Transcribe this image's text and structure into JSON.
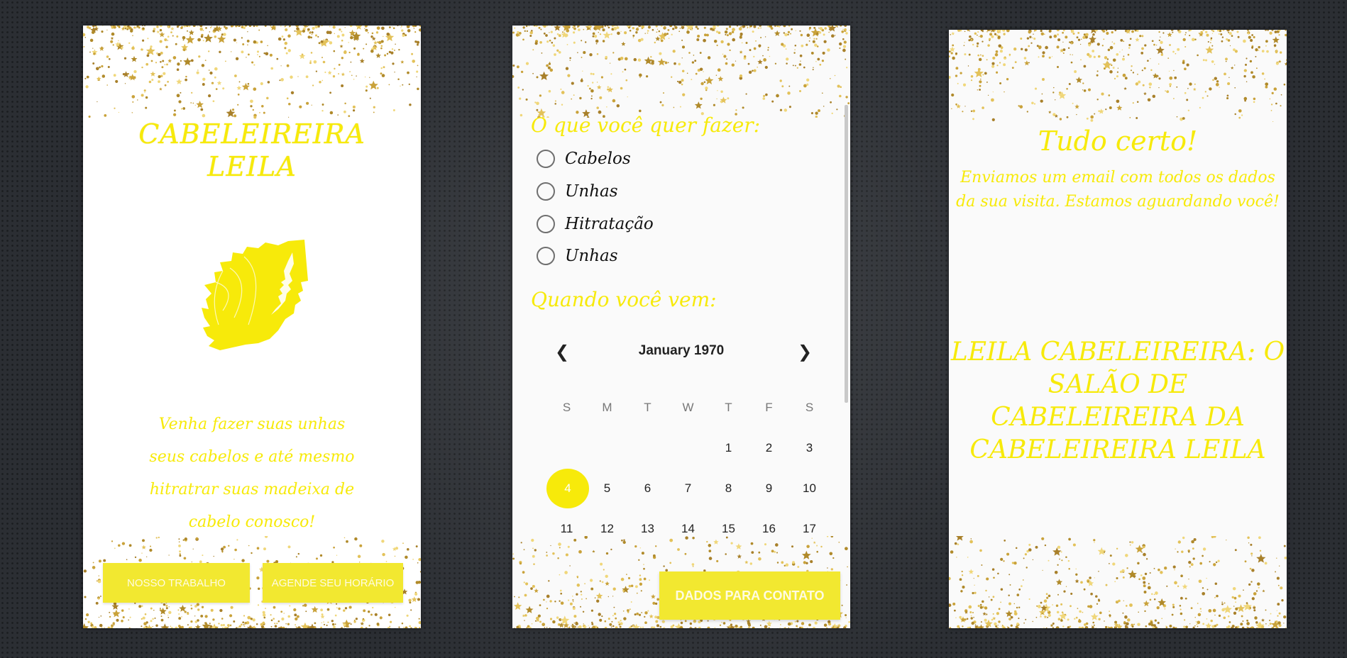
{
  "screen1": {
    "title": "CABELEIREIRA LEILA",
    "logo_icon": "woman-hair-silhouette-icon",
    "description": "Venha fazer suas unhas seus cabelos e até mesmo hitratrar suas madeixa de cabelo conosco!",
    "buttons": {
      "our_work": "NOSSO TRABALHO",
      "book": "AGENDE SEU HORÁRIO"
    }
  },
  "screen2": {
    "question_service": "O que você quer fazer:",
    "options": [
      "Cabelos",
      "Unhas",
      "Hitratação",
      "Unhas"
    ],
    "question_when": "Quando você vem:",
    "calendar": {
      "month": "January 1970",
      "weekdays": [
        "S",
        "M",
        "T",
        "W",
        "T",
        "F",
        "S"
      ],
      "weeks": [
        [
          "",
          "",
          "",
          "",
          "1",
          "2",
          "3"
        ],
        [
          "4",
          "5",
          "6",
          "7",
          "8",
          "9",
          "10"
        ],
        [
          "11",
          "12",
          "13",
          "14",
          "15",
          "16",
          "17"
        ]
      ],
      "selected": "4"
    },
    "contact_button": "DADOS PARA CONTATO"
  },
  "screen3": {
    "title": "Tudo certo!",
    "message": "Enviamos um email com todos os dados da sua visita. Estamos aguardando você!",
    "tagline": "LEILA CABELEIREIRA: O SALÃO DE CABELEIREIRA DA CABELEIREIRA LEILA"
  },
  "colors": {
    "accent_yellow": "#f7ea0a",
    "button_yellow": "#f2e830",
    "glitter_gold": "#c9a23a"
  }
}
